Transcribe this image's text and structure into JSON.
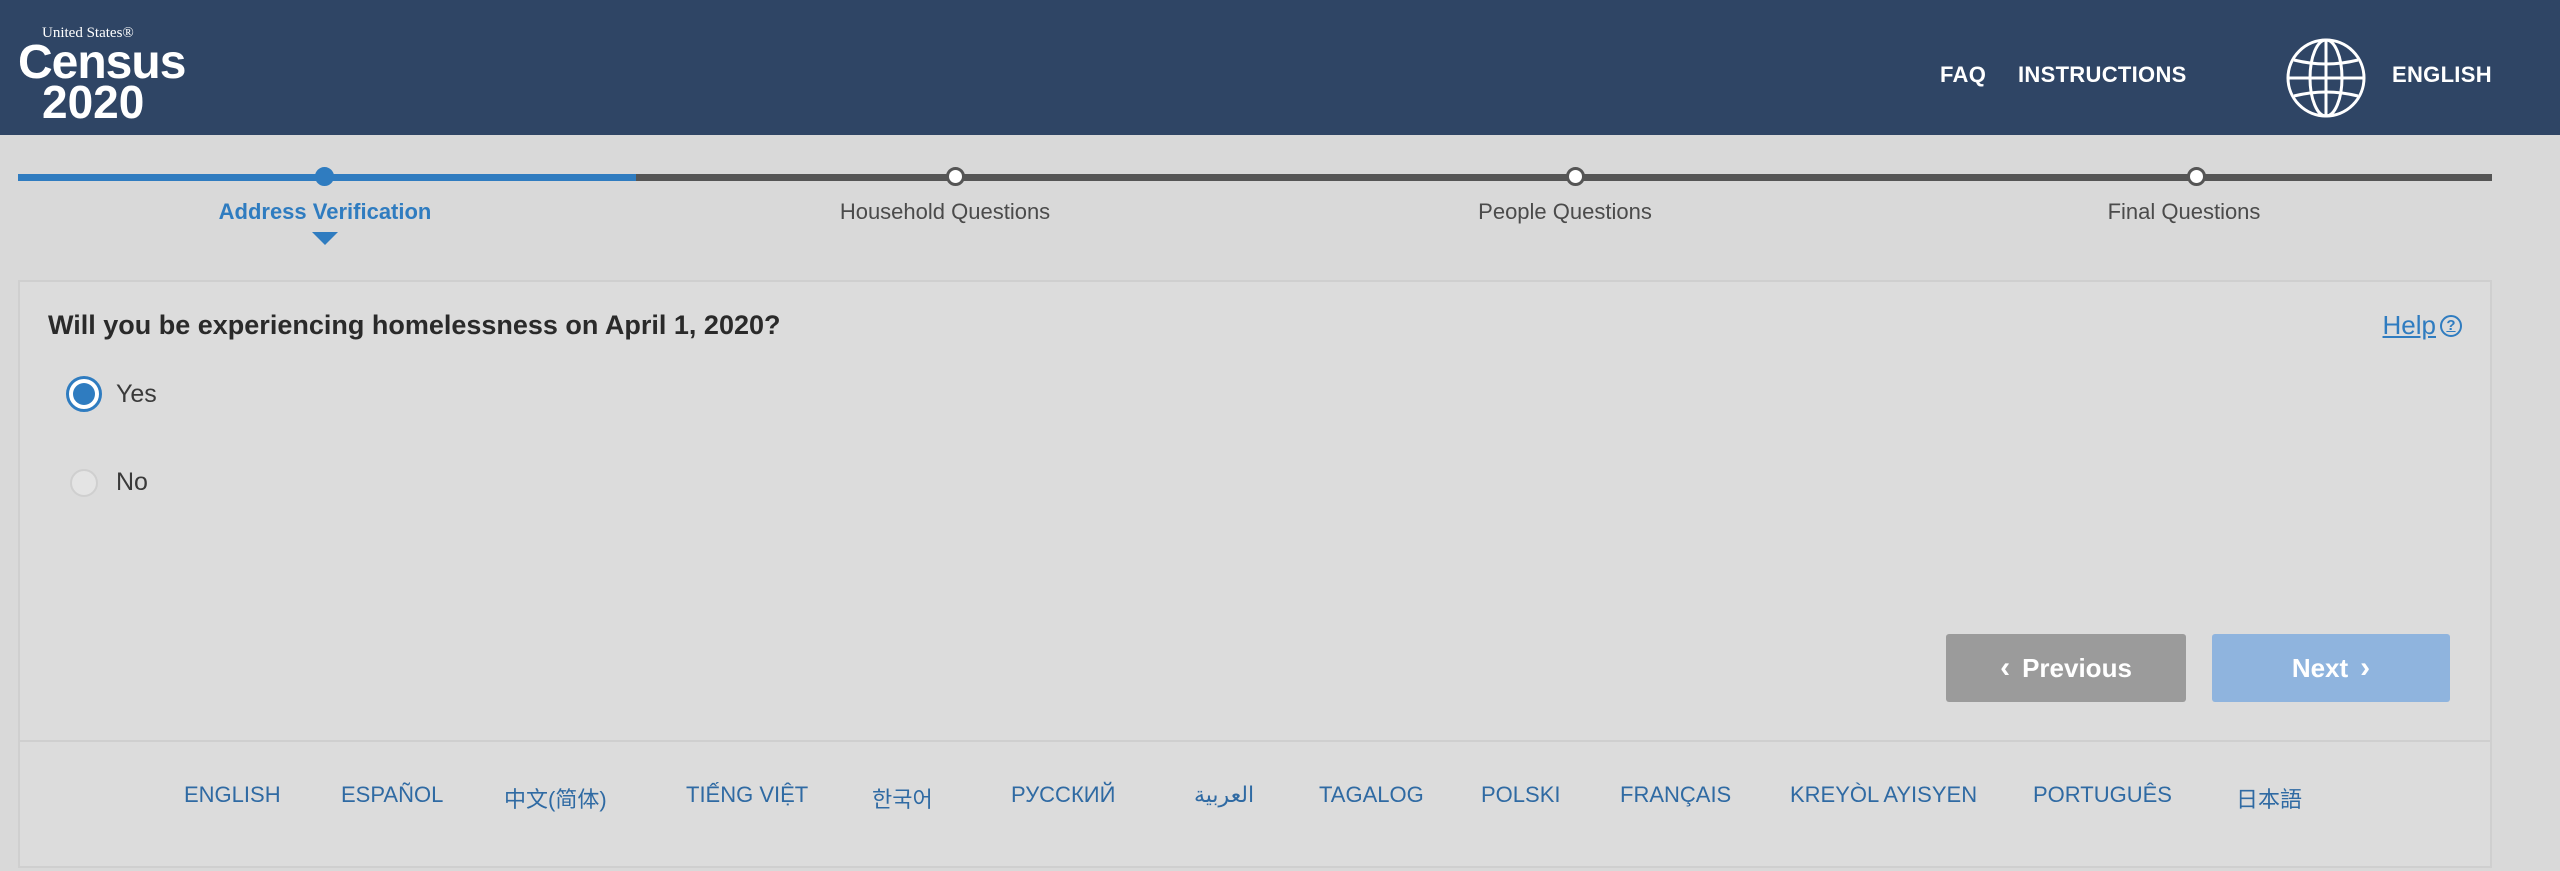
{
  "header": {
    "logo": {
      "line1": "United States®",
      "line2": "Census",
      "line3": "2020"
    },
    "nav": {
      "faq": "FAQ",
      "instructions": "INSTRUCTIONS",
      "language": "ENGLISH"
    }
  },
  "progress": {
    "steps": [
      {
        "label": "Address Verification",
        "active": true
      },
      {
        "label": "Household Questions",
        "active": false
      },
      {
        "label": "People Questions",
        "active": false
      },
      {
        "label": "Final Questions",
        "active": false
      }
    ]
  },
  "question": {
    "text": "Will you be experiencing homelessness on April 1, 2020?",
    "help_label": "Help",
    "help_icon": "?",
    "options": [
      {
        "label": "Yes",
        "selected": true
      },
      {
        "label": "No",
        "selected": false
      }
    ]
  },
  "buttons": {
    "previous": "Previous",
    "next": "Next"
  },
  "languages": [
    "ENGLISH",
    "ESPAÑOL",
    "中文(简体)",
    "TIẾNG VIỆT",
    "한국어",
    "РУССКИЙ",
    "العربية",
    "TAGALOG",
    "POLSKI",
    "FRANÇAIS",
    "KREYÒL AYISYEN",
    "PORTUGUÊS",
    "日本語"
  ],
  "colors": {
    "header_bg": "#2f4565",
    "accent": "#2f7cc0",
    "page_bg": "#d9d9d9"
  }
}
